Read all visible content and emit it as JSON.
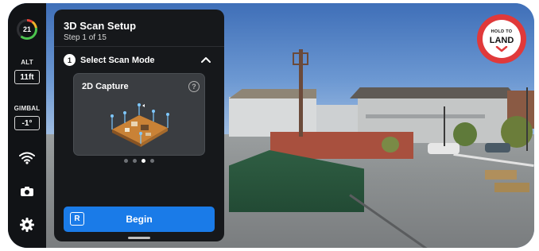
{
  "status": {
    "battery_value": "21",
    "alt_label": "ALT",
    "alt_value": "11ft",
    "gimbal_label": "GIMBAL",
    "gimbal_value": "-1°"
  },
  "rail_icons": [
    "wifi-icon",
    "camera-icon",
    "gear-icon"
  ],
  "panel": {
    "title": "3D Scan Setup",
    "step": "Step 1 of 15",
    "section_number": "1",
    "section_label": "Select Scan Mode",
    "card_title": "2D Capture",
    "help_glyph": "?",
    "pager_total": 4,
    "pager_active": 3,
    "begin_key": "R",
    "begin_label": "Begin"
  },
  "land": {
    "line1": "HOLD TO",
    "line2": "LAND"
  },
  "colors": {
    "accent": "#1a7be8",
    "land_red": "#e0393a",
    "panel_bg": "#16181b"
  }
}
